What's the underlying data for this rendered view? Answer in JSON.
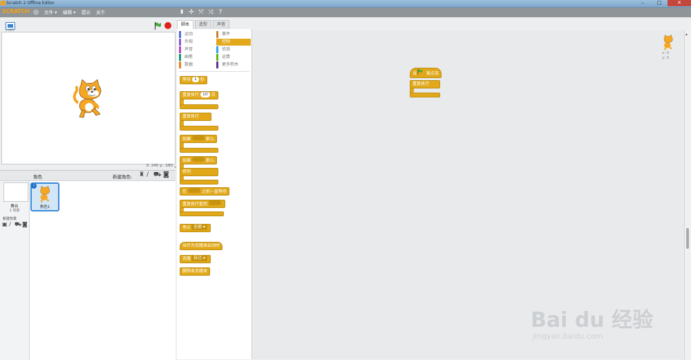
{
  "window": {
    "title": "Scratch 2 Offline Editor",
    "minimize": "–",
    "maximize": "□",
    "close": "✕"
  },
  "menubar": {
    "logo": "SCRATCH",
    "items": [
      "文件 ▾",
      "编辑 ▾",
      "提示",
      "关于"
    ]
  },
  "stage": {
    "mode_label": "v.461",
    "coords": "X: 240  y: -180"
  },
  "tabs": [
    "脚本",
    "造型",
    "声音"
  ],
  "categories": [
    {
      "label": "运动",
      "color": "#4a6cd4"
    },
    {
      "label": "事件",
      "color": "#c88330"
    },
    {
      "label": "外观",
      "color": "#8a55d7"
    },
    {
      "label": "控制",
      "color": "#e1a91a",
      "selected": true
    },
    {
      "label": "声音",
      "color": "#bb42c3"
    },
    {
      "label": "侦测",
      "color": "#2ca5e2"
    },
    {
      "label": "画笔",
      "color": "#0e9a6c"
    },
    {
      "label": "运算",
      "color": "#5cb712"
    },
    {
      "label": "数据",
      "color": "#ee7d16"
    },
    {
      "label": "更多积木",
      "color": "#632d99"
    }
  ],
  "blocks": {
    "wait_pre": "等待",
    "wait_val": "1",
    "wait_post": "秒",
    "repeat_pre": "重复执行",
    "repeat_val": "10",
    "repeat_post": "次",
    "forever": "重复执行",
    "if_pre": "如果",
    "if_post": "那么",
    "ifelse_pre": "如果",
    "ifelse_post": "那么",
    "else": "否则",
    "waituntil_pre": "在",
    "waituntil_post": "之前一直等待",
    "repeatuntil": "重复执行直到",
    "stop_pre": "停止",
    "stop_val": "全部 ▾",
    "clone_hat": "当作为克隆体启动时",
    "clone_pre": "克隆",
    "clone_val": "自己 ▾",
    "delete_clone": "删除本克隆体"
  },
  "script": {
    "hat_pre": "当",
    "hat_post": "被点击",
    "forever": "重复执行"
  },
  "sprite_pane": {
    "header": "角色",
    "new_sprite": "新建角色:",
    "stage_label": "舞台",
    "stage_count": "1 背景",
    "new_backdrop": "新建背景",
    "sprite_name": "角色1"
  },
  "sprite_info": {
    "x": "x: 0",
    "y": "y: 0"
  },
  "watermark": {
    "brand": "Bai du 经验",
    "url": "jingyan.baidu.com"
  }
}
